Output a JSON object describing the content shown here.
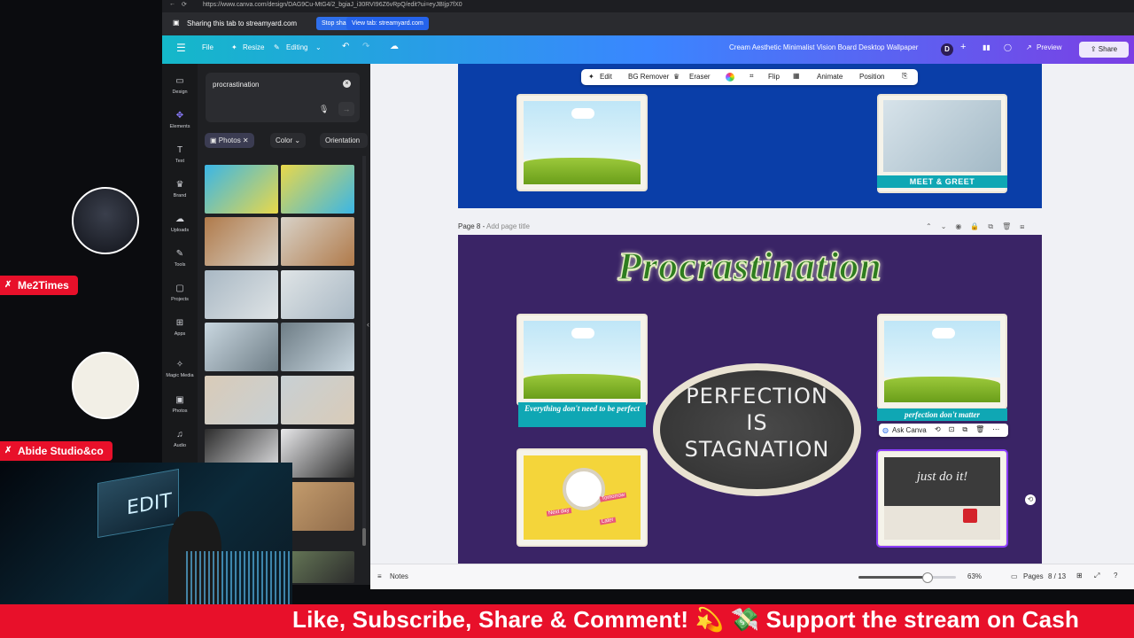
{
  "browser": {
    "url": "https://www.canva.com/design/DAG9Cu-MtG4/2_bgiaJ_i30RVI96Z6vRpQ/edit?ui=eyJBIjp7fX0",
    "sharing_text": "Sharing this tab to streamyard.com",
    "stop_sharing": "Stop sharing",
    "view_tab": "View tab: streamyard.com"
  },
  "topbar": {
    "menu_icon": "menu-icon",
    "file": "File",
    "resize": "Resize",
    "editing": "Editing",
    "doc_title": "Cream Aesthetic Minimalist Vision Board Desktop Wallpaper",
    "avatar_initial": "D",
    "preview": "Preview",
    "share": "Share"
  },
  "rail": [
    {
      "label": "Design",
      "icon": "design-icon"
    },
    {
      "label": "Elements",
      "icon": "elements-icon"
    },
    {
      "label": "Text",
      "icon": "text-icon"
    },
    {
      "label": "Brand",
      "icon": "brand-icon"
    },
    {
      "label": "Uploads",
      "icon": "uploads-icon"
    },
    {
      "label": "Tools",
      "icon": "tools-icon"
    },
    {
      "label": "Projects",
      "icon": "projects-icon"
    },
    {
      "label": "Apps",
      "icon": "apps-icon"
    },
    {
      "label": "Magic Media",
      "icon": "magic-media-icon"
    },
    {
      "label": "Photos",
      "icon": "photos-icon"
    },
    {
      "label": "Audio",
      "icon": "audio-icon"
    }
  ],
  "panel": {
    "search_value": "procrastination",
    "chips": {
      "photos": "Photos",
      "color": "Color",
      "orientation": "Orientation"
    }
  },
  "toolbar": {
    "edit": "Edit",
    "bg_remover": "BG Remover",
    "eraser": "Eraser",
    "flip": "Flip",
    "animate": "Animate",
    "position": "Position"
  },
  "page7": {
    "ribbon": "MEET & GREET"
  },
  "page8": {
    "label": "Page 8 -",
    "add_title": "Add page title",
    "heading": "Procrastination",
    "ribbon_left": "Everything don't need to be perfect",
    "ribbon_right": "perfection don't matter",
    "chalk_line1": "PERFECTION",
    "chalk_line2": "IS",
    "chalk_line3": "STAGNATION",
    "chalk_small": "just do it!",
    "clock_tags": [
      "Next day",
      "Tomorrow",
      "Later"
    ],
    "ask_canva": "Ask Canva"
  },
  "bottom": {
    "notes": "Notes",
    "zoom": "63%",
    "pages": "Pages",
    "page_count": "8 / 13",
    "zoom_level": 0.7
  },
  "stream": {
    "guest1": "Me2Times",
    "guest2": "Abide Studio&co",
    "edit_sign": "EDIT",
    "ticker": "Like, Subscribe, Share & Comment! 💫 💸 Support the stream on Cash"
  },
  "colors": {
    "canva_gradient_start": "#14b8c9",
    "canva_gradient_end": "#7b3fe4",
    "page7_bg": "#0a3ea8",
    "page8_bg": "#3a2466",
    "ticker_bg": "#e8102a",
    "heading_green": "#2e7d1f"
  }
}
